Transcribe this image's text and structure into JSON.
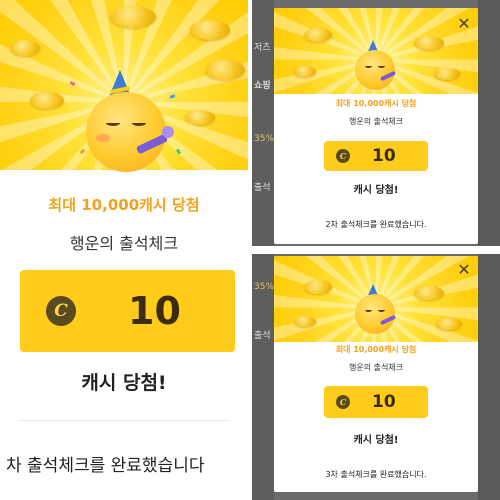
{
  "left_panel": {
    "prize_title": "최대 10,000캐시 당첨",
    "subtitle": "행운의 출석체크",
    "coin_symbol": "C",
    "coin_amount": "10",
    "won_text": "캐시 당첨!",
    "completion_text": "차 출석체크를 완료했습니다"
  },
  "top_right_popup": {
    "prize_title": "최대 10,000캐시 당첨",
    "subtitle": "행운의 출석체크",
    "coin_symbol": "C",
    "coin_amount": "10",
    "won_text": "캐시 당첨!",
    "completion_text": "2차 출석체크를 완료했습니다.",
    "close_symbol": "✕",
    "bg_fragments": [
      "저츠",
      "쇼핑",
      "35%",
      "출석"
    ]
  },
  "bottom_right_popup": {
    "prize_title": "최대 10,000캐시 당첨",
    "subtitle": "행운의 출석체크",
    "coin_symbol": "C",
    "coin_amount": "10",
    "won_text": "캐시 당첨!",
    "completion_text": "3차 출석체크를 완료했습니다.",
    "close_symbol": "✕",
    "bg_fragments": [
      "35%",
      "출석"
    ]
  },
  "colors": {
    "prize_orange": "#f2a21c",
    "coin_box_yellow": "#ffcc1c",
    "coin_icon_brown": "#5a4a1f",
    "dim_overlay": "#6b6b6b"
  },
  "icons": {
    "emoji": "partying-face-emoji",
    "coin": "cash-coin-icon",
    "close": "close-icon"
  }
}
